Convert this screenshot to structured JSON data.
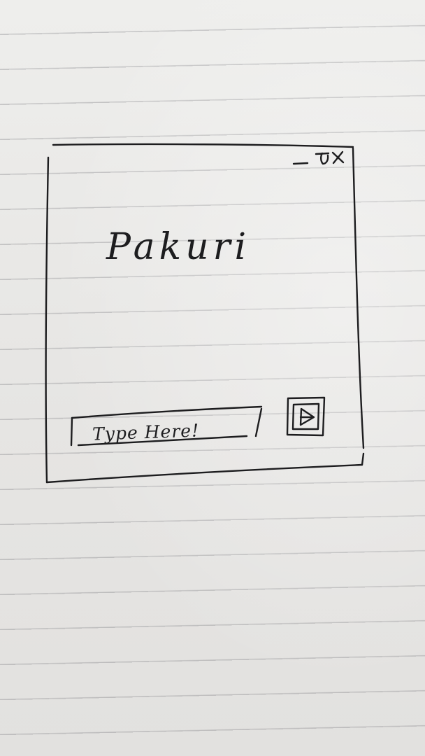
{
  "window": {
    "title": "Pakuri",
    "controls": {
      "minimize_icon": "minimize-icon",
      "maximize_icon": "maximize-icon",
      "close_icon": "close-icon"
    }
  },
  "input": {
    "placeholder": "Type Here!"
  },
  "send_button": {
    "icon": "play-icon"
  },
  "colors": {
    "ink": "#1d1d1f",
    "paper": "#e9e8e6"
  }
}
